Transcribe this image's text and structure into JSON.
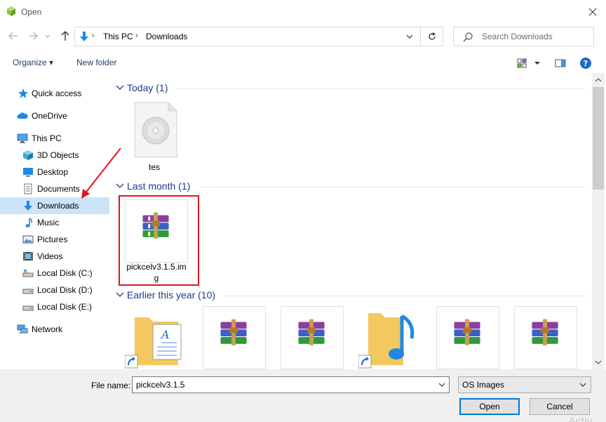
{
  "window": {
    "title": "Open",
    "close_label": "×"
  },
  "address": {
    "breadcrumb": [
      "This PC",
      "Downloads"
    ],
    "separator": "›"
  },
  "search": {
    "placeholder": "Search Downloads"
  },
  "toolbar": {
    "organize": "Organize ▾",
    "new_folder": "New folder"
  },
  "sidebar": {
    "items": [
      {
        "label": "Quick access",
        "icon": "star-icon"
      },
      {
        "label": "OneDrive",
        "icon": "cloud-icon"
      },
      {
        "label": "This PC",
        "icon": "computer-icon"
      },
      {
        "label": "3D Objects",
        "icon": "cube-icon"
      },
      {
        "label": "Desktop",
        "icon": "desktop-icon"
      },
      {
        "label": "Documents",
        "icon": "documents-icon"
      },
      {
        "label": "Downloads",
        "icon": "download-icon",
        "selected": true
      },
      {
        "label": "Music",
        "icon": "music-icon"
      },
      {
        "label": "Pictures",
        "icon": "pictures-icon"
      },
      {
        "label": "Videos",
        "icon": "videos-icon"
      },
      {
        "label": "Local Disk (C:)",
        "icon": "drive-icon"
      },
      {
        "label": "Local Disk (D:)",
        "icon": "drive-icon"
      },
      {
        "label": "Local Disk (E:)",
        "icon": "drive-icon"
      },
      {
        "label": "Network",
        "icon": "network-icon"
      }
    ]
  },
  "groups": [
    {
      "title": "Today (1)",
      "files": [
        {
          "name": "tes",
          "icon": "disc-image-icon"
        }
      ]
    },
    {
      "title": "Last month (1)",
      "files": [
        {
          "name": "pickcelv3.1.5.img",
          "icon": "winrar-archive-icon"
        }
      ]
    },
    {
      "title": "Earlier this year (10)",
      "files": [
        {
          "name": "",
          "icon": "document-folder-shortcut-icon"
        },
        {
          "name": "",
          "icon": "winrar-archive-icon"
        },
        {
          "name": "",
          "icon": "winrar-archive-icon"
        },
        {
          "name": "",
          "icon": "music-folder-shortcut-icon"
        },
        {
          "name": "",
          "icon": "winrar-archive-icon"
        },
        {
          "name": "",
          "icon": "winrar-archive-icon"
        }
      ]
    }
  ],
  "footer": {
    "file_name_label": "File name:",
    "file_name_value": "pickcelv3.1.5",
    "file_type": "OS Images",
    "open_label": "Open",
    "cancel_label": "Cancel",
    "watermark": "Activ"
  },
  "colors": {
    "accent": "#0078d7",
    "selection": "#cce4f7",
    "group_header": "#1e3a8a",
    "highlight": "#e0141e"
  }
}
